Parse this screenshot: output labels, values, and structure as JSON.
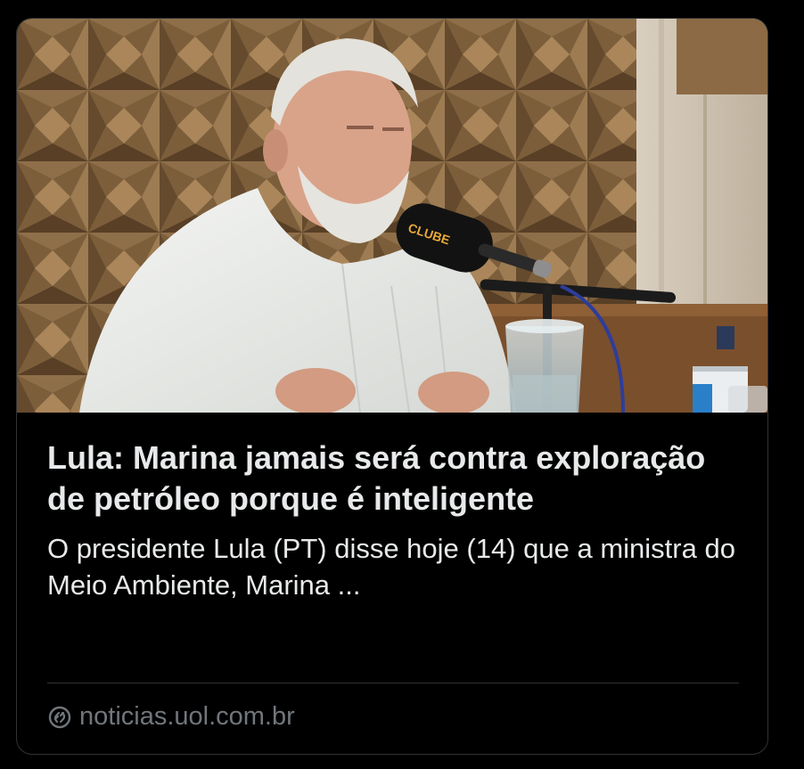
{
  "card": {
    "headline": "Lula: Marina jamais será contra exploração de petróleo porque é inteligente",
    "description": "O presidente Lula (PT) disse hoje (14) que a ministra do Meio Ambiente, Marina ...",
    "source_domain": "noticias.uol.com.br",
    "source_icon": "globe-link-icon",
    "image": {
      "description_icon": "article-photo",
      "mic_label": "CLUBE"
    }
  },
  "colors": {
    "background": "#000000",
    "text_primary": "#e7e9ea",
    "text_secondary": "#71767b",
    "border": "#2f3336"
  }
}
